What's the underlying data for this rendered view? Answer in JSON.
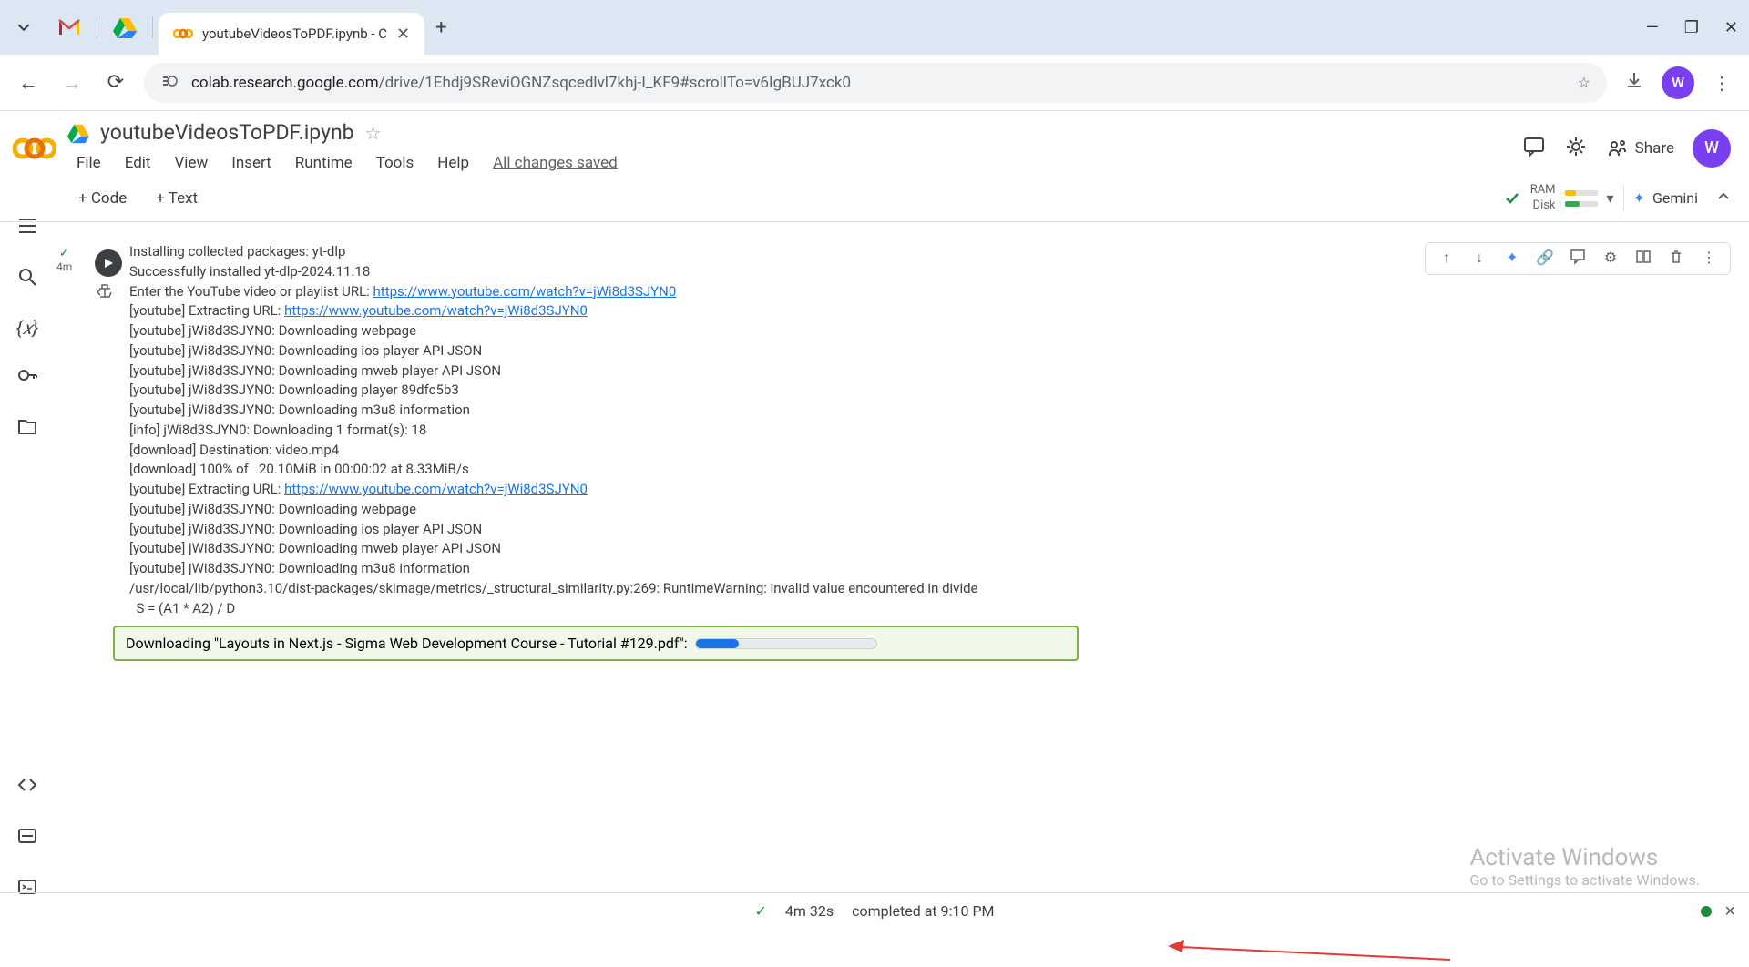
{
  "browser": {
    "tab_title": "youtubeVideosToPDF.ipynb - C",
    "url_domain": "colab.research.google.com",
    "url_path": "/drive/1Ehdj9SReviOGNZsqcedlvl7khj-I_KF9#scrollTo=v6IgBUJ7xck0",
    "avatar_letter": "W"
  },
  "doc": {
    "filename": "youtubeVideosToPDF.ipynb",
    "menus": [
      "File",
      "Edit",
      "View",
      "Insert",
      "Runtime",
      "Tools",
      "Help"
    ],
    "saved_text": "All changes saved",
    "share_label": "Share"
  },
  "toolbar": {
    "add_code": "+ Code",
    "add_text": "+ Text",
    "ram_label": "RAM",
    "disk_label": "Disk",
    "gemini_label": "Gemini"
  },
  "cell": {
    "run_time_short": "4m",
    "output_lines": [
      {
        "pre": "Installing collected packages: yt-dlp",
        "url": ""
      },
      {
        "pre": "Successfully installed yt-dlp-2024.11.18",
        "url": ""
      },
      {
        "pre": "Enter the YouTube video or playlist URL: ",
        "url": "https://www.youtube.com/watch?v=jWi8d3SJYN0"
      },
      {
        "pre": "[youtube] Extracting URL: ",
        "url": "https://www.youtube.com/watch?v=jWi8d3SJYN0"
      },
      {
        "pre": "[youtube] jWi8d3SJYN0: Downloading webpage",
        "url": ""
      },
      {
        "pre": "[youtube] jWi8d3SJYN0: Downloading ios player API JSON",
        "url": ""
      },
      {
        "pre": "[youtube] jWi8d3SJYN0: Downloading mweb player API JSON",
        "url": ""
      },
      {
        "pre": "[youtube] jWi8d3SJYN0: Downloading player 89dfc5b3",
        "url": ""
      },
      {
        "pre": "[youtube] jWi8d3SJYN0: Downloading m3u8 information",
        "url": ""
      },
      {
        "pre": "[info] jWi8d3SJYN0: Downloading 1 format(s): 18",
        "url": ""
      },
      {
        "pre": "[download] Destination: video.mp4",
        "url": ""
      },
      {
        "pre": "[download] 100% of   20.10MiB in 00:00:02 at 8.33MiB/s",
        "url": ""
      },
      {
        "pre": "[youtube] Extracting URL: ",
        "url": "https://www.youtube.com/watch?v=jWi8d3SJYN0"
      },
      {
        "pre": "[youtube] jWi8d3SJYN0: Downloading webpage",
        "url": ""
      },
      {
        "pre": "[youtube] jWi8d3SJYN0: Downloading ios player API JSON",
        "url": ""
      },
      {
        "pre": "[youtube] jWi8d3SJYN0: Downloading mweb player API JSON",
        "url": ""
      },
      {
        "pre": "[youtube] jWi8d3SJYN0: Downloading m3u8 information",
        "url": ""
      },
      {
        "pre": "/usr/local/lib/python3.10/dist-packages/skimage/metrics/_structural_similarity.py:269: RuntimeWarning: invalid value encountered in divide",
        "url": ""
      },
      {
        "pre": "  S = (A1 * A2) / D",
        "url": ""
      }
    ],
    "download_text": "Downloading \"Layouts in Next.js - Sigma Web Development Course - Tutorial #129.pdf\":"
  },
  "status": {
    "elapsed": "4m 32s",
    "completed": "completed at 9:10 PM"
  },
  "watermark": {
    "title": "Activate Windows",
    "subtitle": "Go to Settings to activate Windows."
  }
}
